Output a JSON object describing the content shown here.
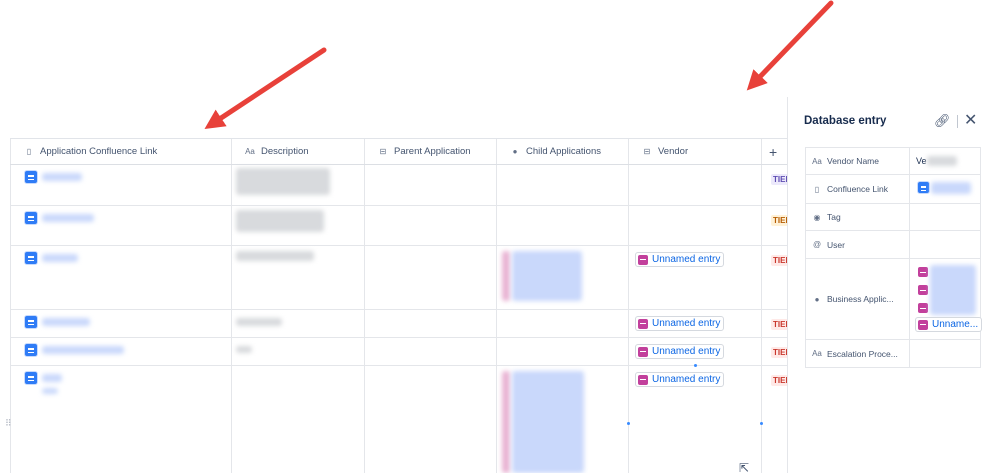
{
  "table": {
    "columns": [
      {
        "label": "Application Confluence Link",
        "icon": "page-icon"
      },
      {
        "label": "Description",
        "icon": "text-icon"
      },
      {
        "label": "Parent Application",
        "icon": "relation-icon"
      },
      {
        "label": "Child Applications",
        "icon": "back-relation-icon"
      },
      {
        "label": "Vendor",
        "icon": "relation-icon"
      }
    ],
    "add_column_label": "+",
    "vendor_chips": [
      "Unnamed entry",
      "Unnamed entry",
      "Unnamed entry",
      "Unnamed entry"
    ],
    "tiers": [
      "TIER",
      "TIER",
      "TIER",
      "TIER",
      "TIER",
      "TIER"
    ]
  },
  "panel": {
    "title": "Database entry",
    "link_icon": "link-icon",
    "close_icon": "close-icon",
    "fields": [
      {
        "label": "Vendor Name",
        "icon": "text-icon",
        "value": "Ve"
      },
      {
        "label": "Confluence Link",
        "icon": "page-icon"
      },
      {
        "label": "Tag",
        "icon": "tag-icon"
      },
      {
        "label": "User",
        "icon": "at-icon"
      },
      {
        "label": "Business Applic...",
        "icon": "back-relation-icon",
        "chip_label": "Unname..."
      },
      {
        "label": "Escalation Proce...",
        "icon": "text-icon"
      }
    ]
  },
  "colors": {
    "arrow": "#e8413a",
    "link": "#0c66e4",
    "relation_pink": "#c2409c",
    "doc_blue": "#2f7cf6"
  }
}
